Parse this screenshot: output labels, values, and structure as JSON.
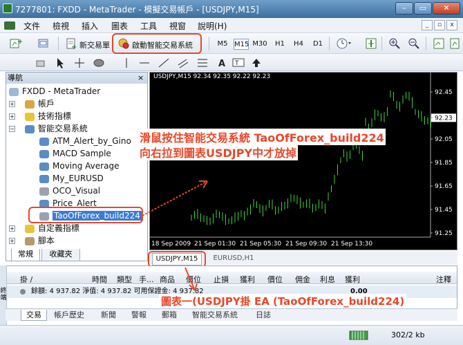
{
  "window": {
    "title": "7277801: FXDD - MetaTrader - 模擬交易帳戶 - [USDJPY,M15]",
    "minimize": "–",
    "maximize": "▭",
    "close": "✕"
  },
  "menu": {
    "items": [
      "文件",
      "檢視",
      "插入",
      "圖表",
      "工具",
      "視窗",
      "說明(H)"
    ],
    "mdi": [
      "_",
      "▫",
      "x"
    ]
  },
  "toolbar": {
    "new_order": "新交易單",
    "auto_trading": "啟動智能交易系統",
    "timeframes": [
      "M5",
      "M15",
      "M30",
      "H1",
      "H4",
      "D1"
    ],
    "active_timeframe": "M15"
  },
  "navigator": {
    "header": "導航",
    "close": "×",
    "root": "FXDD - MetaTrader",
    "items": [
      {
        "label": "帳戶",
        "indent": 1,
        "expander": "+"
      },
      {
        "label": "技術指標",
        "indent": 1,
        "expander": "+"
      },
      {
        "label": "智能交易系統",
        "indent": 1,
        "expander": "−"
      },
      {
        "label": "ATM_Alert_by_Gino",
        "indent": 2
      },
      {
        "label": "MACD Sample",
        "indent": 2
      },
      {
        "label": "Moving Average",
        "indent": 2
      },
      {
        "label": "My_EURUSD",
        "indent": 2
      },
      {
        "label": "OCO_Visual",
        "indent": 2
      },
      {
        "label": "Price_Alert",
        "indent": 2
      },
      {
        "label": "TaoOfForex_build224",
        "indent": 2,
        "selected": true
      },
      {
        "label": "自定義指標",
        "indent": 1,
        "expander": "+"
      },
      {
        "label": "腳本",
        "indent": 1,
        "expander": "+"
      }
    ],
    "tabs": [
      "常規",
      "收藏夾"
    ]
  },
  "chart": {
    "header": "USDJPY,M15   92.34 92.35 92.22 92.23",
    "price_labels": [
      "92.45",
      "92.23",
      "92.05",
      "91.85",
      "91.65",
      "91.45",
      "91.25"
    ],
    "current_price": "92.23",
    "time_labels": [
      "18 Sep 2009",
      "21 Sep 01:30",
      "21 Sep 05:30",
      "21 Sep 09:30",
      "21 Sep 13:30"
    ],
    "tabs": [
      "USDJPY,M15",
      "EURUSD,H1"
    ]
  },
  "annotations": {
    "line1": "滑鼠按住智能交易系統 TaoOfForex_build224",
    "line2": "向右拉到圖表USDJPY中才放掉",
    "line3": "圖表一(USDJPY掛 EA (TaoOfForex_build224)"
  },
  "terminal": {
    "side_label": "終端",
    "columns": [
      "掛 /",
      "時間",
      "類型",
      "手...",
      "商品",
      "價位",
      "止損",
      "獲利",
      "價位",
      "佣金",
      "利息",
      "獲利",
      "注釋"
    ],
    "balance_line": "餘額: 4 937.82  淨值: 4 937.82  可用保證金: 4 937.82",
    "profit": "0.00",
    "tabs": [
      "交易",
      "帳戶歷史",
      "新聞",
      "警報",
      "郵箱",
      "智能交易系統",
      "日誌"
    ]
  },
  "status": {
    "traffic": "302/2 kb"
  }
}
